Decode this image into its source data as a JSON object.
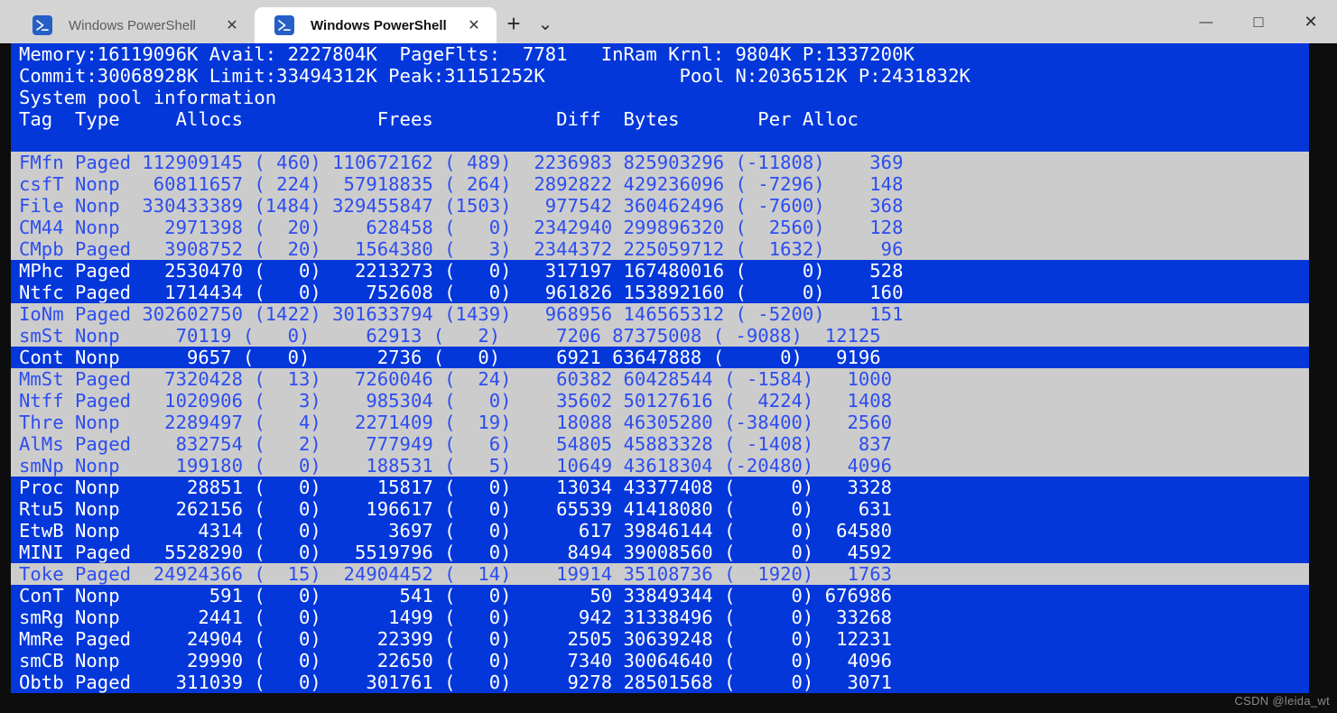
{
  "window": {
    "titlebar_bg": "#d4d4d4",
    "controls": {
      "minimize_label": "—",
      "maximize_label": "□",
      "close_label": "✕"
    },
    "tabs": [
      {
        "title": "Windows PowerShell",
        "active": false,
        "close_label": "✕",
        "icon": "powershell-icon"
      },
      {
        "title": "Windows PowerShell",
        "active": true,
        "close_label": "✕",
        "icon": "powershell-icon"
      }
    ],
    "new_tab_label": "+",
    "tab_menu_label": "⌄"
  },
  "terminal": {
    "colors": {
      "background": "#0d0d0d",
      "text_normal": "#2c4df0",
      "text_selected": "#ffffff",
      "row_bg": "#cccccc",
      "selection_bg": "#0437da"
    },
    "header_lines": [
      {
        "text": "Memory:16119096K Avail: 2227804K  PageFlts:  7781   InRam Krnl: 9804K P:1337200K",
        "selected": true
      },
      {
        "text": "Commit:30068928K Limit:33494312K Peak:31151252K            Pool N:2036512K P:2431832K",
        "selected": true
      },
      {
        "text": "System pool information",
        "selected": true
      },
      {
        "text": "Tag  Type     Allocs            Frees           Diff  Bytes       Per Alloc",
        "selected": true
      },
      {
        "text": "",
        "selected": true
      }
    ],
    "rows": [
      {
        "text": "FMfn Paged 112909145 ( 460) 110672162 ( 489)  2236983 825903296 (-11808)    369",
        "selected": false
      },
      {
        "text": "csfT Nonp   60811657 ( 224)  57918835 ( 264)  2892822 429236096 ( -7296)    148",
        "selected": false
      },
      {
        "text": "File Nonp  330433389 (1484) 329455847 (1503)   977542 360462496 ( -7600)    368",
        "selected": false
      },
      {
        "text": "CM44 Nonp    2971398 (  20)    628458 (   0)  2342940 299896320 (  2560)    128",
        "selected": false
      },
      {
        "text": "CMpb Paged   3908752 (  20)   1564380 (   3)  2344372 225059712 (  1632)     96",
        "selected": false
      },
      {
        "text": "MPhc Paged   2530470 (   0)   2213273 (   0)   317197 167480016 (     0)    528",
        "selected": true
      },
      {
        "text": "Ntfc Paged   1714434 (   0)    752608 (   0)   961826 153892160 (     0)    160",
        "selected": true
      },
      {
        "text": "IoNm Paged 302602750 (1422) 301633794 (1439)   968956 146565312 ( -5200)    151",
        "selected": false
      },
      {
        "text": "smSt Nonp     70119 (   0)     62913 (   2)     7206 87375008 ( -9088)  12125",
        "selected": false
      },
      {
        "text": "Cont Nonp      9657 (   0)      2736 (   0)     6921 63647888 (     0)   9196",
        "selected": true
      },
      {
        "text": "MmSt Paged   7320428 (  13)   7260046 (  24)    60382 60428544 ( -1584)   1000",
        "selected": false
      },
      {
        "text": "Ntff Paged   1020906 (   3)    985304 (   0)    35602 50127616 (  4224)   1408",
        "selected": false
      },
      {
        "text": "Thre Nonp    2289497 (   4)   2271409 (  19)    18088 46305280 (-38400)   2560",
        "selected": false
      },
      {
        "text": "AlMs Paged    832754 (   2)    777949 (   6)    54805 45883328 ( -1408)    837",
        "selected": false
      },
      {
        "text": "smNp Nonp     199180 (   0)    188531 (   5)    10649 43618304 (-20480)   4096",
        "selected": false
      },
      {
        "text": "Proc Nonp      28851 (   0)     15817 (   0)    13034 43377408 (     0)   3328",
        "selected": true
      },
      {
        "text": "Rtu5 Nonp     262156 (   0)    196617 (   0)    65539 41418080 (     0)    631",
        "selected": true
      },
      {
        "text": "EtwB Nonp       4314 (   0)      3697 (   0)      617 39846144 (     0)  64580",
        "selected": true
      },
      {
        "text": "MINI Paged   5528290 (   0)   5519796 (   0)     8494 39008560 (     0)   4592",
        "selected": true
      },
      {
        "text": "Toke Paged  24924366 (  15)  24904452 (  14)    19914 35108736 (  1920)   1763",
        "selected": false
      },
      {
        "text": "ConT Nonp        591 (   0)       541 (   0)       50 33849344 (     0) 676986",
        "selected": true
      },
      {
        "text": "smRg Nonp       2441 (   0)      1499 (   0)      942 31338496 (     0)  33268",
        "selected": true
      },
      {
        "text": "MmRe Paged     24904 (   0)     22399 (   0)     2505 30639248 (     0)  12231",
        "selected": true
      },
      {
        "text": "smCB Nonp      29990 (   0)     22650 (   0)     7340 30064640 (     0)   4096",
        "selected": true
      },
      {
        "text": "Obtb Paged    311039 (   0)    301761 (   0)     9278 28501568 (     0)   3071",
        "selected": true
      }
    ]
  },
  "watermark": "CSDN @leida_wt"
}
